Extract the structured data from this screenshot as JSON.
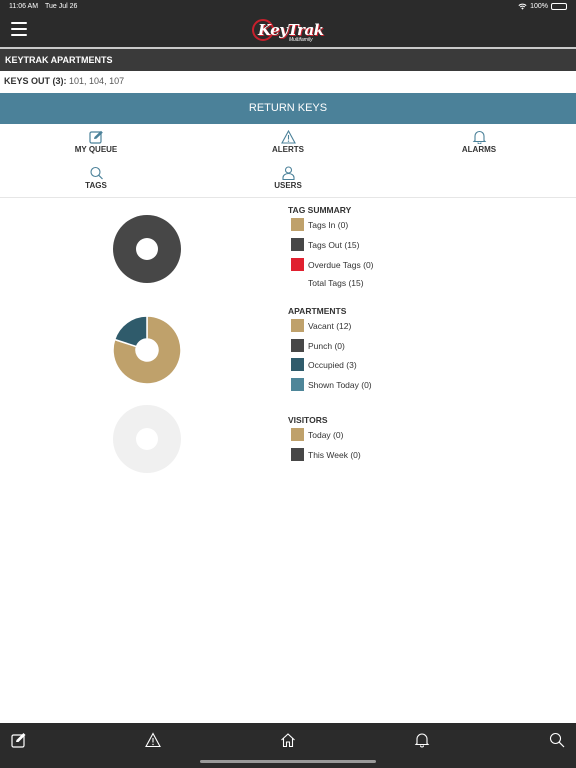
{
  "status_bar": {
    "time": "11:06 AM",
    "date": "Tue Jul 26",
    "battery": "100%"
  },
  "header": {
    "logo_text": "KeyTrak",
    "logo_sub": "Multifamily"
  },
  "property": {
    "title": "KEYTRAK APARTMENTS"
  },
  "keys_out": {
    "label": "KEYS OUT (3):",
    "values": "101, 104, 107"
  },
  "return_keys": {
    "label": "RETURN KEYS"
  },
  "nav": {
    "my_queue": "MY QUEUE",
    "alerts": "ALERTS",
    "alarms": "ALARMS",
    "tags": "TAGS",
    "users": "USERS"
  },
  "colors": {
    "tan": "#bfa16b",
    "dark": "#474747",
    "red": "#e0202f",
    "teal": "#2f5b6b",
    "blue": "#4e8699",
    "empty": "#f0f0f0"
  },
  "tag_summary": {
    "title": "TAG SUMMARY",
    "tags_in": "Tags In (0)",
    "tags_out": "Tags Out (15)",
    "overdue": "Overdue Tags (0)",
    "total": "Total Tags (15)"
  },
  "apartments": {
    "title": "APARTMENTS",
    "vacant": "Vacant (12)",
    "punch": "Punch (0)",
    "occupied": "Occupied (3)",
    "shown_today": "Shown Today (0)"
  },
  "visitors": {
    "title": "VISITORS",
    "today": "Today (0)",
    "this_week": "This Week (0)"
  },
  "chart_data": [
    {
      "type": "pie",
      "categories": [
        "Tags In",
        "Tags Out",
        "Overdue Tags"
      ],
      "values": [
        0,
        15,
        0
      ]
    },
    {
      "type": "pie",
      "categories": [
        "Vacant",
        "Punch",
        "Occupied",
        "Shown Today"
      ],
      "values": [
        12,
        0,
        3,
        0
      ]
    },
    {
      "type": "pie",
      "categories": [
        "Today",
        "This Week"
      ],
      "values": [
        0,
        0
      ]
    }
  ],
  "bottom_nav": [
    "edit-icon",
    "alert-icon",
    "home-icon",
    "bell-icon",
    "search-icon"
  ]
}
